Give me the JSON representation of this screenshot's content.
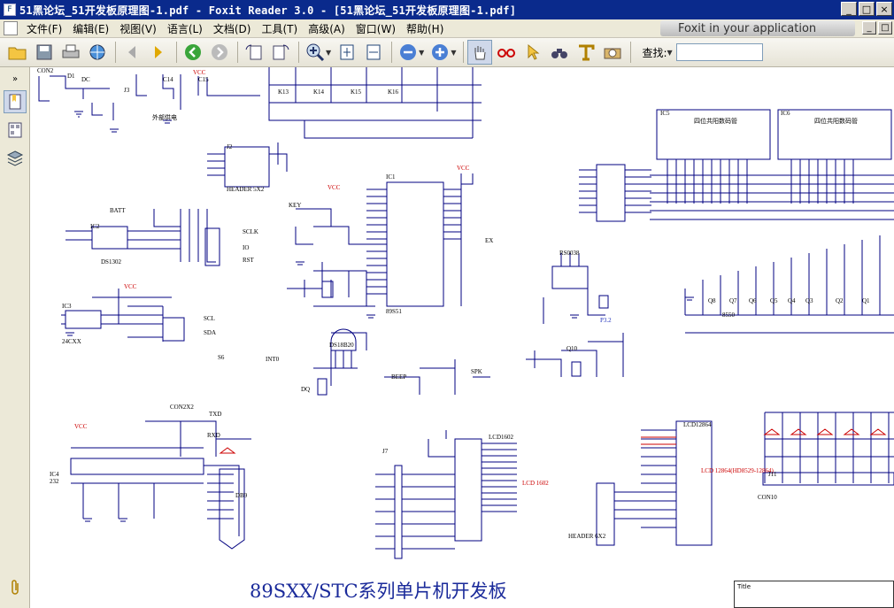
{
  "window": {
    "title": "51黑论坛_51开发板原理图-1.pdf - Foxit Reader 3.0 - [51黑论坛_51开发板原理图-1.pdf]",
    "buttons": {
      "minimize": "_",
      "maximize": "□",
      "close": "×"
    }
  },
  "menu": {
    "items": [
      "文件(F)",
      "编辑(E)",
      "视图(V)",
      "语言(L)",
      "文档(D)",
      "工具(T)",
      "高级(A)",
      "窗口(W)",
      "帮助(H)"
    ],
    "banner": "Foxit in your application"
  },
  "toolbar": {
    "find_label": "查找:",
    "find_value": ""
  },
  "document": {
    "board_title": "89SXX/STC系列单片机开发板",
    "title_block_label": "Title",
    "labels": {
      "con2": "CON2",
      "d1": "D1",
      "dc": "DC",
      "j3": "J3",
      "vcc": "VCC",
      "c15": "C15",
      "c14": "C14",
      "ext_power": "外部供电",
      "k13": "K13",
      "k14": "K14",
      "k15": "K15",
      "k16": "K16",
      "header": "HEADER 5X2",
      "j2": "J2",
      "batt": "BATT",
      "ic2": "IC2",
      "ds1302": "DS1302",
      "sclk": "SCLK",
      "io": "IO",
      "rst": "RST",
      "ic1": "IC1",
      "chip89": "89S51",
      "ic3": "IC3",
      "x24": "24CXX",
      "scl": "SCL",
      "sda": "SDA",
      "key": "KEY",
      "s6": "S6",
      "int0": "INT0",
      "ds18b20": "DS18B20",
      "dq": "DQ",
      "beep": "BEEP",
      "spk": "SPK",
      "con2x2": "CON2X2",
      "txd": "TXD",
      "rxd": "RXD",
      "db9": "DB9",
      "ic4": "IC4",
      "max232": "232",
      "j7": "J7",
      "lcd1602": "LCD1602",
      "lcd1602b": "LCD 1602",
      "lcd12864": "LCD12864",
      "lcd12864_full": "LCD 12864(HD8529-12864)",
      "header8": "HEADER 6X2",
      "ic5": "IC5",
      "ic6": "IC6",
      "seg_title": "四位共阳数码管",
      "j11": "J11",
      "con10": "CON10",
      "ex": "EX",
      "q10": "Q10",
      "ir": "RS0038",
      "p32": "P3.2",
      "q1": "Q1",
      "q2": "Q2",
      "q3": "Q3",
      "q4": "Q4",
      "q5": "Q5",
      "q6": "Q6",
      "q7": "Q7",
      "q8": "Q8",
      "x8550": "8550"
    }
  },
  "colors": {
    "titlebar": "#0a2a8c",
    "wire": "#000080",
    "label": "#000000",
    "net": "#2233bb",
    "power": "#cc0000",
    "board_title": "#1a2a9a"
  }
}
